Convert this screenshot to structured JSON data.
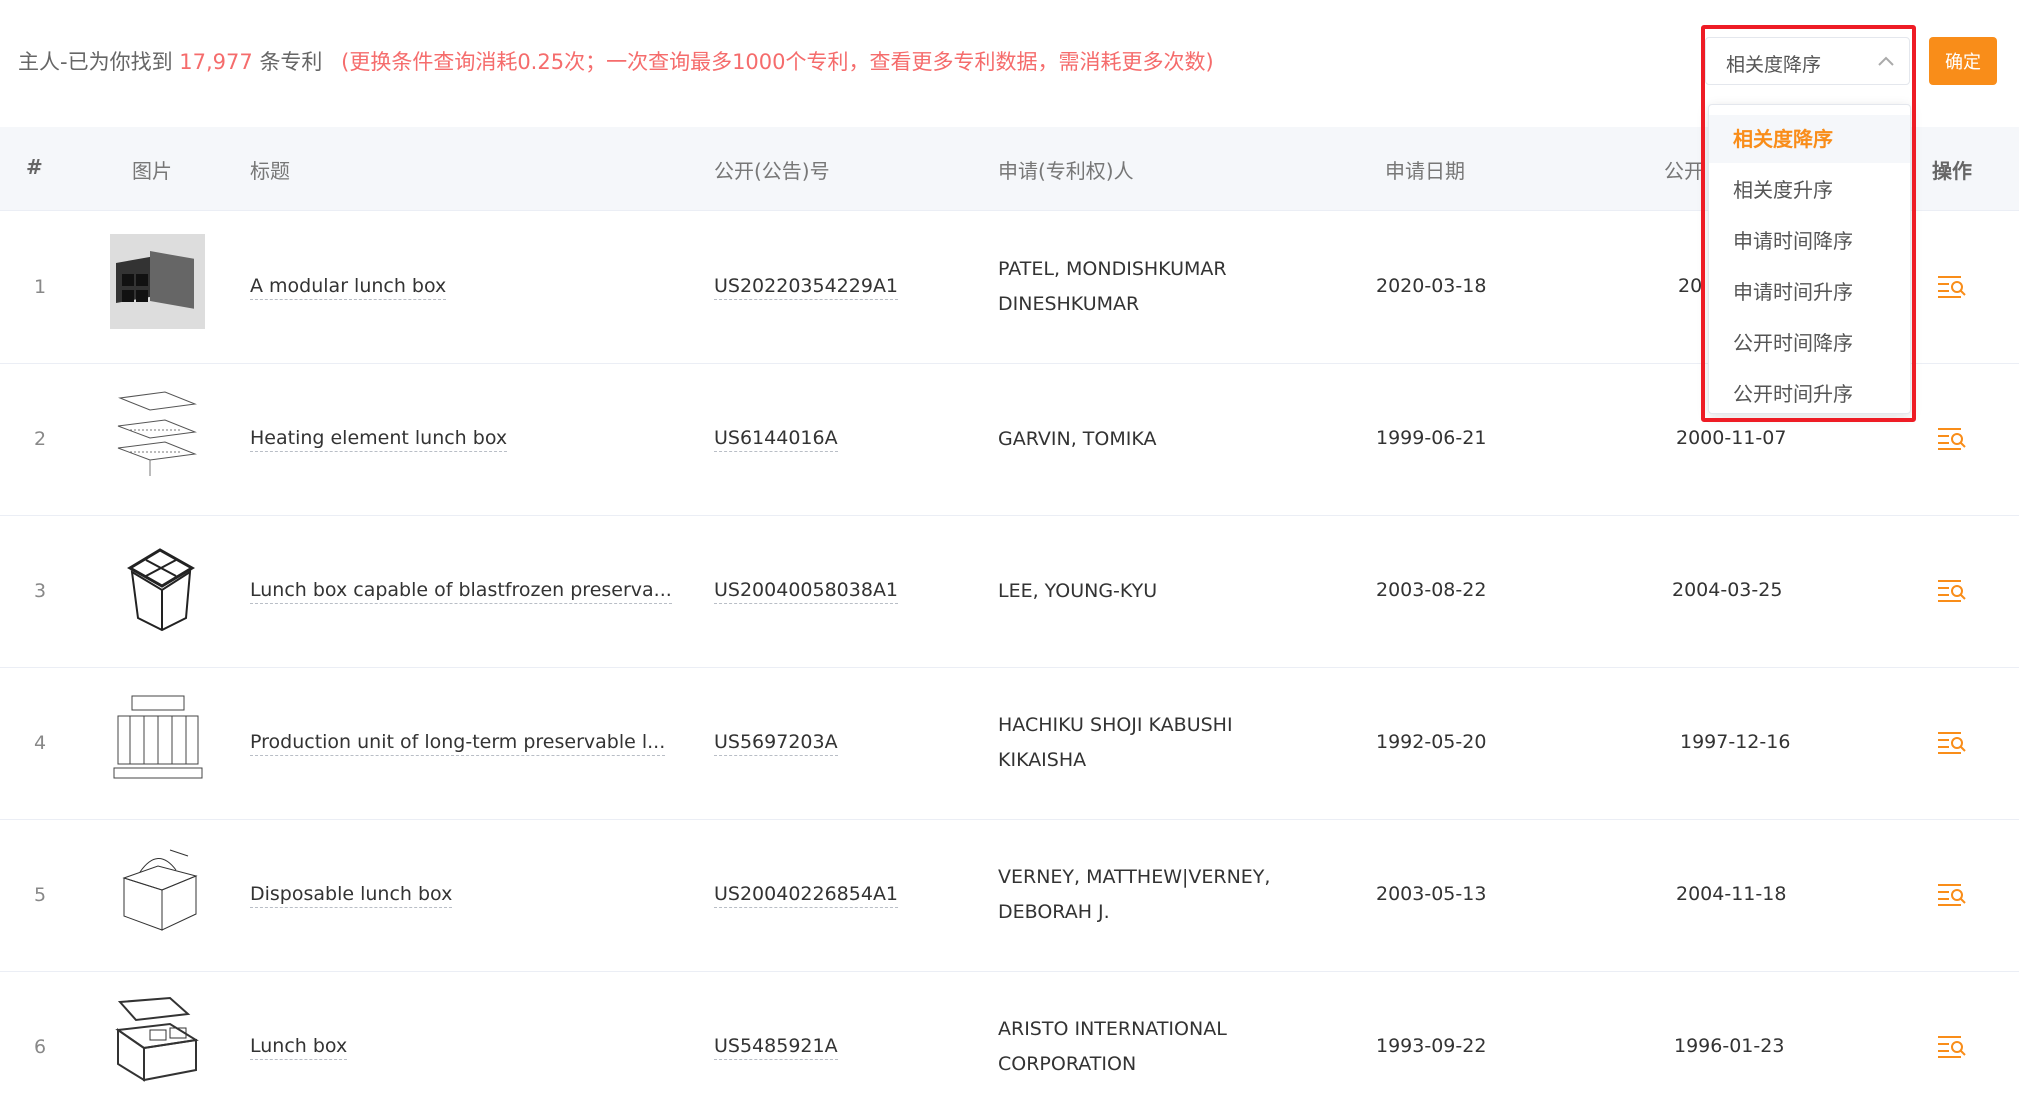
{
  "summary": {
    "prefix": "主人-已为你找到",
    "count": "17,977",
    "unit": "条专利",
    "note": "(更换条件查询消耗0.25次；一次查询最多1000个专利，查看更多专利数据，需消耗更多次数)"
  },
  "sort": {
    "selected": "相关度降序",
    "options": [
      "相关度降序",
      "相关度升序",
      "申请时间降序",
      "申请时间升序",
      "公开时间降序",
      "公开时间升序"
    ]
  },
  "confirm_label": "确定",
  "columns": [
    "#",
    "图片",
    "标题",
    "公开(公告)号",
    "申请(专利权)人",
    "申请日期",
    "公开",
    "操作"
  ],
  "rows": [
    {
      "index": "1",
      "title": "A modular lunch box",
      "pub_no": "US20220354229A1",
      "applicant": "PATEL, MONDISHKUMAR DINESHKUMAR",
      "app_date": "2020-03-18",
      "pub_date": "20"
    },
    {
      "index": "2",
      "title": "Heating element lunch box",
      "pub_no": "US6144016A",
      "applicant": "GARVIN, TOMIKA",
      "app_date": "1999-06-21",
      "pub_date": "2000-11-07"
    },
    {
      "index": "3",
      "title": "Lunch box capable of blastfrozen preserva...",
      "pub_no": "US20040058038A1",
      "applicant": "LEE, YOUNG-KYU",
      "app_date": "2003-08-22",
      "pub_date": "2004-03-25"
    },
    {
      "index": "4",
      "title": "Production unit of long-term preservable l...",
      "pub_no": "US5697203A",
      "applicant": "HACHIKU SHOJI KABUSHI KIKAISHA",
      "app_date": "1992-05-20",
      "pub_date": "1997-12-16"
    },
    {
      "index": "5",
      "title": "Disposable lunch box",
      "pub_no": "US20040226854A1",
      "applicant": "VERNEY, MATTHEW|VERNEY, DEBORAH J.",
      "app_date": "2003-05-13",
      "pub_date": "2004-11-18"
    },
    {
      "index": "6",
      "title": "Lunch box",
      "pub_no": "US5485921A",
      "applicant": "ARISTO INTERNATIONAL CORPORATION",
      "app_date": "1993-09-22",
      "pub_date": "1996-01-23"
    }
  ],
  "colors": {
    "accent": "#f98d19",
    "warning": "#f56c6c",
    "highlight": "#ee1c25"
  }
}
